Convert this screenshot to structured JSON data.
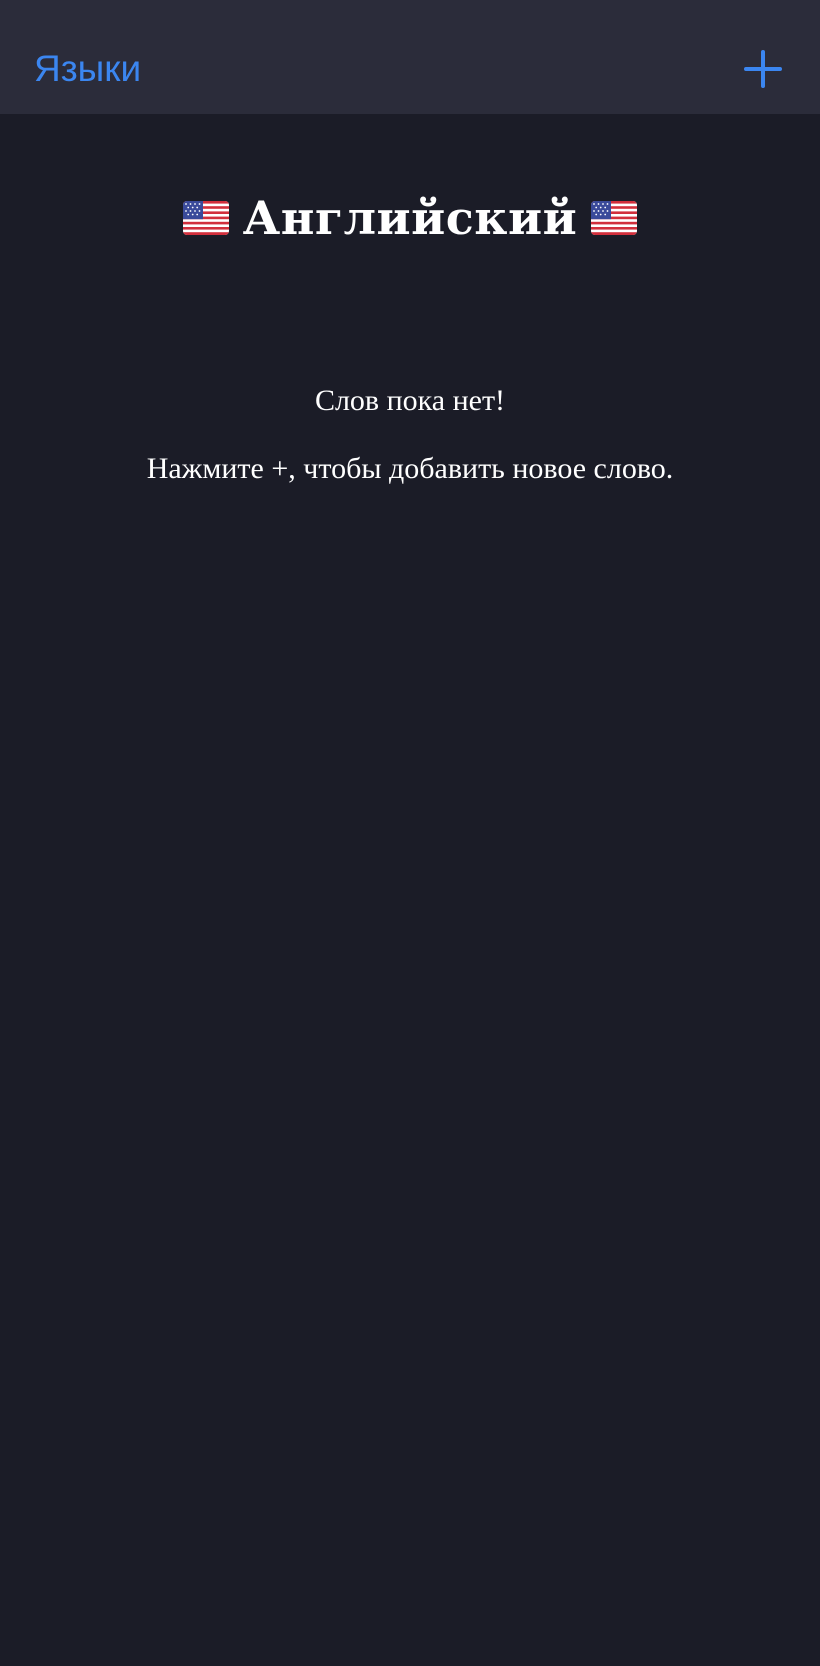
{
  "nav": {
    "back_label": "Языки",
    "add_icon": "plus-icon",
    "accent_color": "#3b86f0",
    "bar_color": "#2b2c3a"
  },
  "header": {
    "title": "Английский",
    "flag_icon": "us-flag-icon"
  },
  "empty_state": {
    "title": "Слов пока нет!",
    "hint": "Нажмите +, чтобы добавить новое слово."
  },
  "background_color": "#1b1c27"
}
